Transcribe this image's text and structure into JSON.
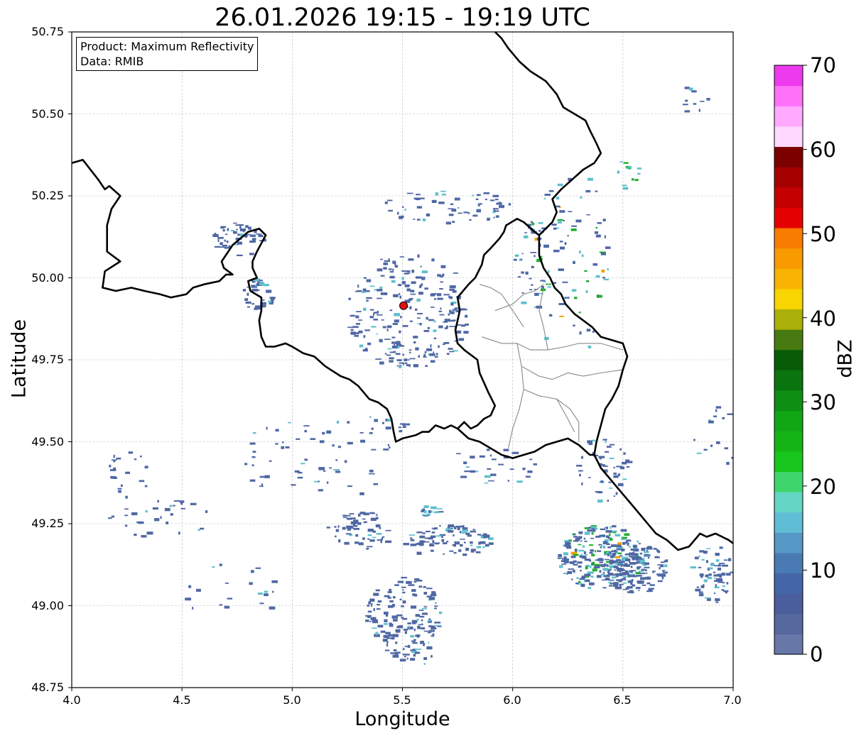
{
  "title": "26.01.2026 19:15 - 19:19 UTC",
  "info": {
    "product": "Product: Maximum Reflectivity",
    "data": "Data: RMIB"
  },
  "axes": {
    "xlabel": "Longitude",
    "ylabel": "Latitude",
    "xlim": [
      4.0,
      7.0
    ],
    "ylim": [
      48.75,
      50.75
    ],
    "xticks": [
      "4.0",
      "4.5",
      "5.0",
      "5.5",
      "6.0",
      "6.5",
      "7.0"
    ],
    "yticks": [
      "48.75",
      "49.00",
      "49.25",
      "49.50",
      "49.75",
      "50.00",
      "50.25",
      "50.50",
      "50.75"
    ],
    "grid": true
  },
  "colorbar": {
    "label": "dBZ",
    "ticks": [
      "0",
      "10",
      "20",
      "30",
      "40",
      "50",
      "60",
      "70"
    ],
    "range": [
      0,
      70
    ],
    "colors": [
      "#6677a8",
      "#56689e",
      "#4a5d9c",
      "#4466a8",
      "#4a7ab4",
      "#5598c6",
      "#5fbdd6",
      "#64d6c4",
      "#3ed66c",
      "#16c61a",
      "#14b414",
      "#10a614",
      "#0e8e12",
      "#0a740e",
      "#085c08",
      "#477a10",
      "#aab008",
      "#f8d400",
      "#f8b400",
      "#f89a00",
      "#f87c00",
      "#e40000",
      "#c40000",
      "#a40000",
      "#7c0000",
      "#ffd8ff",
      "#ffaaff",
      "#ff70f8",
      "#ee3aee"
    ]
  },
  "radar_site": {
    "lon": 5.505,
    "lat": 49.915,
    "color": "#e01010"
  },
  "palette": {
    "border": "#000000",
    "district": "#888888",
    "grid": "#bbbbbb",
    "weak": "#4f68a4",
    "mid": "#5fc0cc",
    "green": "#1fae2a",
    "orange": "#f0a000"
  },
  "echoes": [
    {
      "lon": 6.4,
      "lat": 49.15,
      "rlon": 0.2,
      "rlat": 0.1,
      "n": 260,
      "strength": "mixed"
    },
    {
      "lon": 6.55,
      "lat": 49.12,
      "rlon": 0.15,
      "rlat": 0.08,
      "n": 140,
      "strength": "weak"
    },
    {
      "lon": 6.9,
      "lat": 49.1,
      "rlon": 0.1,
      "rlat": 0.09,
      "n": 70,
      "strength": "weak"
    },
    {
      "lon": 5.5,
      "lat": 48.97,
      "rlon": 0.17,
      "rlat": 0.12,
      "n": 150,
      "strength": "weak"
    },
    {
      "lon": 5.3,
      "lat": 49.23,
      "rlon": 0.15,
      "rlat": 0.06,
      "n": 60,
      "strength": "weak"
    },
    {
      "lon": 5.7,
      "lat": 49.2,
      "rlon": 0.2,
      "rlat": 0.05,
      "n": 90,
      "strength": "weak"
    },
    {
      "lon": 5.62,
      "lat": 49.29,
      "rlon": 0.04,
      "rlat": 0.02,
      "n": 18,
      "strength": "mid"
    },
    {
      "lon": 5.52,
      "lat": 49.9,
      "rlon": 0.28,
      "rlat": 0.18,
      "n": 240,
      "strength": "weak"
    },
    {
      "lon": 5.7,
      "lat": 50.22,
      "rlon": 0.3,
      "rlat": 0.05,
      "n": 60,
      "strength": "weak"
    },
    {
      "lon": 4.75,
      "lat": 50.12,
      "rlon": 0.12,
      "rlat": 0.05,
      "n": 50,
      "strength": "weak"
    },
    {
      "lon": 4.84,
      "lat": 49.95,
      "rlon": 0.07,
      "rlat": 0.05,
      "n": 35,
      "strength": "weak"
    },
    {
      "lon": 6.4,
      "lat": 49.42,
      "rlon": 0.12,
      "rlat": 0.1,
      "n": 50,
      "strength": "weak"
    },
    {
      "lon": 6.25,
      "lat": 50.05,
      "rlon": 0.18,
      "rlat": 0.3,
      "n": 80,
      "strength": "mixed"
    },
    {
      "lon": 6.08,
      "lat": 50.05,
      "rlon": 0.08,
      "rlat": 0.15,
      "n": 40,
      "strength": "mixed"
    },
    {
      "lon": 5.1,
      "lat": 49.45,
      "rlon": 0.45,
      "rlat": 0.12,
      "n": 60,
      "strength": "weak"
    },
    {
      "lon": 6.95,
      "lat": 49.5,
      "rlon": 0.15,
      "rlat": 0.12,
      "n": 30,
      "strength": "weak"
    },
    {
      "lon": 4.4,
      "lat": 49.27,
      "rlon": 0.25,
      "rlat": 0.06,
      "n": 30,
      "strength": "weak"
    },
    {
      "lon": 4.25,
      "lat": 49.4,
      "rlon": 0.1,
      "rlat": 0.08,
      "n": 20,
      "strength": "weak"
    },
    {
      "lon": 5.9,
      "lat": 49.43,
      "rlon": 0.2,
      "rlat": 0.06,
      "n": 30,
      "strength": "weak"
    },
    {
      "lon": 4.7,
      "lat": 49.05,
      "rlon": 0.3,
      "rlat": 0.08,
      "n": 20,
      "strength": "weak"
    },
    {
      "lon": 6.8,
      "lat": 50.55,
      "rlon": 0.1,
      "rlat": 0.04,
      "n": 10,
      "strength": "weak"
    },
    {
      "lon": 6.52,
      "lat": 50.32,
      "rlon": 0.05,
      "rlat": 0.05,
      "n": 12,
      "strength": "green"
    },
    {
      "lon": 5.4,
      "lat": 49.55,
      "rlon": 0.12,
      "rlat": 0.03,
      "n": 15,
      "strength": "weak"
    },
    {
      "lon": 5.55,
      "lat": 48.85,
      "rlon": 0.1,
      "rlat": 0.05,
      "n": 15,
      "strength": "weak"
    }
  ],
  "borders": {
    "belgium": [
      [
        4.0,
        50.35
      ],
      [
        4.05,
        50.36
      ],
      [
        4.12,
        50.3
      ],
      [
        4.15,
        50.27
      ],
      [
        4.17,
        50.28
      ],
      [
        4.22,
        50.25
      ],
      [
        4.18,
        50.21
      ],
      [
        4.16,
        50.16
      ],
      [
        4.16,
        50.08
      ],
      [
        4.22,
        50.05
      ],
      [
        4.15,
        50.02
      ],
      [
        4.14,
        49.97
      ],
      [
        4.2,
        49.96
      ],
      [
        4.27,
        49.97
      ],
      [
        4.33,
        49.96
      ],
      [
        4.4,
        49.95
      ],
      [
        4.45,
        49.94
      ],
      [
        4.52,
        49.95
      ],
      [
        4.55,
        49.97
      ],
      [
        4.6,
        49.98
      ],
      [
        4.67,
        49.99
      ],
      [
        4.7,
        50.01
      ],
      [
        4.73,
        50.01
      ],
      [
        4.69,
        50.03
      ],
      [
        4.68,
        50.05
      ],
      [
        4.73,
        50.1
      ],
      [
        4.8,
        50.14
      ],
      [
        4.85,
        50.15
      ],
      [
        4.88,
        50.13
      ],
      [
        4.84,
        50.08
      ],
      [
        4.82,
        50.05
      ],
      [
        4.82,
        50.03
      ],
      [
        4.84,
        50.0
      ],
      [
        4.8,
        49.99
      ],
      [
        4.81,
        49.96
      ],
      [
        4.86,
        49.94
      ],
      [
        4.86,
        49.9
      ],
      [
        4.85,
        49.87
      ],
      [
        4.86,
        49.82
      ],
      [
        4.88,
        49.79
      ],
      [
        4.92,
        49.79
      ],
      [
        4.97,
        49.8
      ],
      [
        5.0,
        49.79
      ],
      [
        5.05,
        49.77
      ],
      [
        5.1,
        49.76
      ],
      [
        5.15,
        49.73
      ],
      [
        5.22,
        49.7
      ],
      [
        5.26,
        49.69
      ],
      [
        5.3,
        49.67
      ],
      [
        5.35,
        49.63
      ],
      [
        5.39,
        49.62
      ],
      [
        5.43,
        49.6
      ],
      [
        5.45,
        49.57
      ],
      [
        5.46,
        49.53
      ],
      [
        5.47,
        49.5
      ],
      [
        5.5,
        49.51
      ],
      [
        5.56,
        49.52
      ],
      [
        5.59,
        49.53
      ],
      [
        5.62,
        49.53
      ],
      [
        5.65,
        49.55
      ],
      [
        5.69,
        49.54
      ],
      [
        5.72,
        49.55
      ],
      [
        5.75,
        49.54
      ],
      [
        5.78,
        49.56
      ],
      [
        5.81,
        49.54
      ],
      [
        5.84,
        49.55
      ],
      [
        5.87,
        49.57
      ],
      [
        5.9,
        49.58
      ],
      [
        5.92,
        49.61
      ],
      [
        5.89,
        49.65
      ],
      [
        5.87,
        49.68
      ],
      [
        5.85,
        49.71
      ],
      [
        5.84,
        49.75
      ],
      [
        5.78,
        49.78
      ],
      [
        5.75,
        49.8
      ],
      [
        5.74,
        49.84
      ],
      [
        5.75,
        49.87
      ],
      [
        5.76,
        49.9
      ],
      [
        5.75,
        49.94
      ],
      [
        5.8,
        49.98
      ],
      [
        5.83,
        50.0
      ],
      [
        5.86,
        50.04
      ],
      [
        5.87,
        50.07
      ],
      [
        5.9,
        50.09
      ],
      [
        5.94,
        50.12
      ],
      [
        5.96,
        50.14
      ],
      [
        5.97,
        50.16
      ],
      [
        6.02,
        50.18
      ],
      [
        6.05,
        50.17
      ],
      [
        6.1,
        50.14
      ],
      [
        6.12,
        50.13
      ],
      [
        6.15,
        50.15
      ],
      [
        6.18,
        50.17
      ],
      [
        6.2,
        50.2
      ],
      [
        6.18,
        50.24
      ],
      [
        6.22,
        50.27
      ],
      [
        6.27,
        50.3
      ],
      [
        6.32,
        50.33
      ],
      [
        6.37,
        50.35
      ],
      [
        6.4,
        50.38
      ],
      [
        6.38,
        50.41
      ],
      [
        6.35,
        50.45
      ],
      [
        6.33,
        50.48
      ],
      [
        6.28,
        50.5
      ],
      [
        6.23,
        50.52
      ],
      [
        6.2,
        50.56
      ],
      [
        6.15,
        50.6
      ],
      [
        6.08,
        50.63
      ],
      [
        6.03,
        50.66
      ],
      [
        5.98,
        50.7
      ],
      [
        5.95,
        50.73
      ],
      [
        5.92,
        50.75
      ]
    ],
    "luxembourg": [
      [
        5.75,
        49.54
      ],
      [
        5.8,
        49.51
      ],
      [
        5.85,
        49.5
      ],
      [
        5.9,
        49.48
      ],
      [
        5.95,
        49.46
      ],
      [
        6.0,
        49.45
      ],
      [
        6.05,
        49.46
      ],
      [
        6.1,
        49.47
      ],
      [
        6.15,
        49.49
      ],
      [
        6.2,
        49.5
      ],
      [
        6.25,
        49.51
      ],
      [
        6.3,
        49.49
      ],
      [
        6.35,
        49.46
      ],
      [
        6.37,
        49.46
      ],
      [
        6.38,
        49.5
      ],
      [
        6.4,
        49.55
      ],
      [
        6.42,
        49.6
      ],
      [
        6.45,
        49.63
      ],
      [
        6.48,
        49.67
      ],
      [
        6.5,
        49.72
      ],
      [
        6.52,
        49.76
      ],
      [
        6.5,
        49.8
      ],
      [
        6.45,
        49.81
      ],
      [
        6.4,
        49.82
      ],
      [
        6.36,
        49.85
      ],
      [
        6.32,
        49.87
      ],
      [
        6.28,
        49.89
      ],
      [
        6.24,
        49.92
      ],
      [
        6.22,
        49.95
      ],
      [
        6.19,
        49.97
      ],
      [
        6.17,
        50.0
      ],
      [
        6.14,
        50.03
      ],
      [
        6.12,
        50.07
      ],
      [
        6.12,
        50.1
      ],
      [
        6.12,
        50.13
      ]
    ],
    "germany_france_south": [
      [
        6.37,
        49.46
      ],
      [
        6.4,
        49.42
      ],
      [
        6.45,
        49.38
      ],
      [
        6.5,
        49.34
      ],
      [
        6.55,
        49.3
      ],
      [
        6.6,
        49.26
      ],
      [
        6.65,
        49.22
      ],
      [
        6.7,
        49.2
      ],
      [
        6.75,
        49.17
      ],
      [
        6.8,
        49.18
      ],
      [
        6.85,
        49.22
      ],
      [
        6.88,
        49.21
      ],
      [
        6.92,
        49.22
      ],
      [
        6.95,
        49.21
      ],
      [
        6.98,
        49.2
      ],
      [
        7.0,
        49.19
      ]
    ]
  },
  "districts": [
    [
      [
        5.92,
        49.9
      ],
      [
        6.0,
        49.92
      ],
      [
        6.05,
        49.95
      ],
      [
        6.1,
        49.96
      ],
      [
        6.14,
        49.98
      ]
    ],
    [
      [
        5.86,
        49.82
      ],
      [
        5.95,
        49.8
      ],
      [
        6.02,
        49.8
      ],
      [
        6.08,
        49.78
      ],
      [
        6.16,
        49.78
      ],
      [
        6.24,
        49.79
      ],
      [
        6.3,
        49.8
      ],
      [
        6.4,
        49.8
      ],
      [
        6.5,
        49.78
      ]
    ],
    [
      [
        6.02,
        49.8
      ],
      [
        6.04,
        49.73
      ],
      [
        6.05,
        49.66
      ],
      [
        6.03,
        49.6
      ],
      [
        6.0,
        49.54
      ],
      [
        5.98,
        49.48
      ]
    ],
    [
      [
        6.04,
        49.73
      ],
      [
        6.12,
        49.7
      ],
      [
        6.18,
        49.69
      ],
      [
        6.25,
        49.71
      ],
      [
        6.32,
        49.7
      ],
      [
        6.4,
        49.71
      ],
      [
        6.5,
        49.72
      ]
    ],
    [
      [
        6.05,
        49.66
      ],
      [
        6.12,
        49.64
      ],
      [
        6.2,
        49.63
      ],
      [
        6.26,
        49.6
      ],
      [
        6.3,
        49.56
      ],
      [
        6.3,
        49.5
      ]
    ],
    [
      [
        6.05,
        49.85
      ],
      [
        6.0,
        49.9
      ],
      [
        5.95,
        49.95
      ],
      [
        5.9,
        49.97
      ],
      [
        5.85,
        49.98
      ]
    ],
    [
      [
        6.16,
        49.78
      ],
      [
        6.14,
        49.85
      ],
      [
        6.12,
        49.9
      ],
      [
        6.14,
        49.97
      ]
    ],
    [
      [
        6.2,
        49.63
      ],
      [
        6.25,
        49.57
      ],
      [
        6.28,
        49.53
      ]
    ]
  ]
}
